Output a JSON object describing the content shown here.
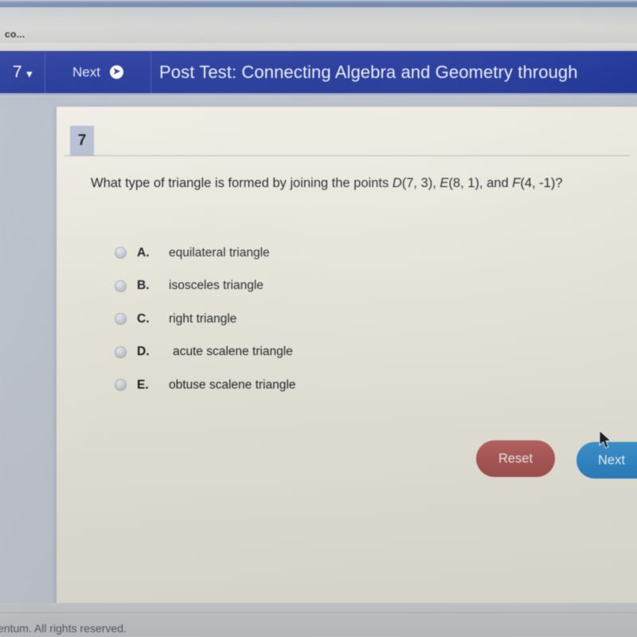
{
  "browser": {
    "tab_label": "co..."
  },
  "navbar": {
    "question_number": "7",
    "dropdown_icon": "chevron-down-icon",
    "next_label": "Next",
    "next_icon": "arrow-right-circle-icon",
    "title": "Post Test: Connecting Algebra and Geometry through"
  },
  "question": {
    "number_badge": "7",
    "text_line1_prefix": "What type of triangle is formed by joining the points ",
    "point_d_label": "D",
    "point_d_coords": "(7, 3), ",
    "point_e_label": "E",
    "point_e_coords": "(8, 1), and",
    "point_f_label": "F",
    "point_f_coords": "(4, -1)?"
  },
  "options": [
    {
      "letter": "A.",
      "text": "equilateral triangle",
      "selected": false
    },
    {
      "letter": "B.",
      "text": "isosceles triangle",
      "selected": false
    },
    {
      "letter": "C.",
      "text": "right triangle",
      "selected": false
    },
    {
      "letter": "D.",
      "text": "acute scalene triangle",
      "selected": false
    },
    {
      "letter": "E.",
      "text": "obtuse scalene triangle",
      "selected": false
    }
  ],
  "actions": {
    "reset_label": "Reset",
    "next_label": "Next"
  },
  "footer": {
    "text": "entum. All rights reserved."
  },
  "colors": {
    "navbar_blue": "#1d3399",
    "next_button_blue": "#2f86c5",
    "reset_button_red": "#a95654",
    "card_background": "#e8e6da",
    "gutter_gray": "#bcc2cb",
    "badge_blue_gray": "#b3bdd0"
  }
}
